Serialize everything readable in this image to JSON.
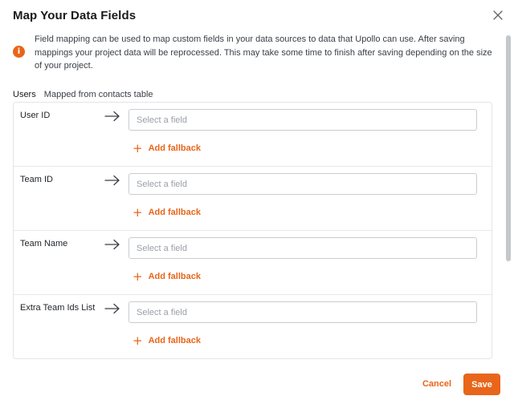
{
  "dialog": {
    "title": "Map Your Data Fields",
    "close_icon": "close-icon"
  },
  "info": {
    "icon": "info-icon",
    "icon_glyph": "i",
    "text": "Field mapping can be used to map custom fields in your data sources to data that Upollo can use. After saving mappings your project data will be reprocessed. This may take some time to finish after saving depending on the size of your project."
  },
  "section": {
    "tab_label": "Users",
    "subtitle": "Mapped from contacts table"
  },
  "fields": [
    {
      "label": "User ID",
      "placeholder": "Select a field",
      "fallback_label": "Add fallback"
    },
    {
      "label": "Team ID",
      "placeholder": "Select a field",
      "fallback_label": "Add fallback"
    },
    {
      "label": "Team Name",
      "placeholder": "Select a field",
      "fallback_label": "Add fallback"
    },
    {
      "label": "Extra Team Ids List",
      "placeholder": "Select a field",
      "fallback_label": "Add fallback"
    }
  ],
  "footer": {
    "cancel_label": "Cancel",
    "save_label": "Save"
  },
  "colors": {
    "accent": "#e8651a",
    "border": "#e3e5e8",
    "placeholder": "#9a9fa6"
  }
}
